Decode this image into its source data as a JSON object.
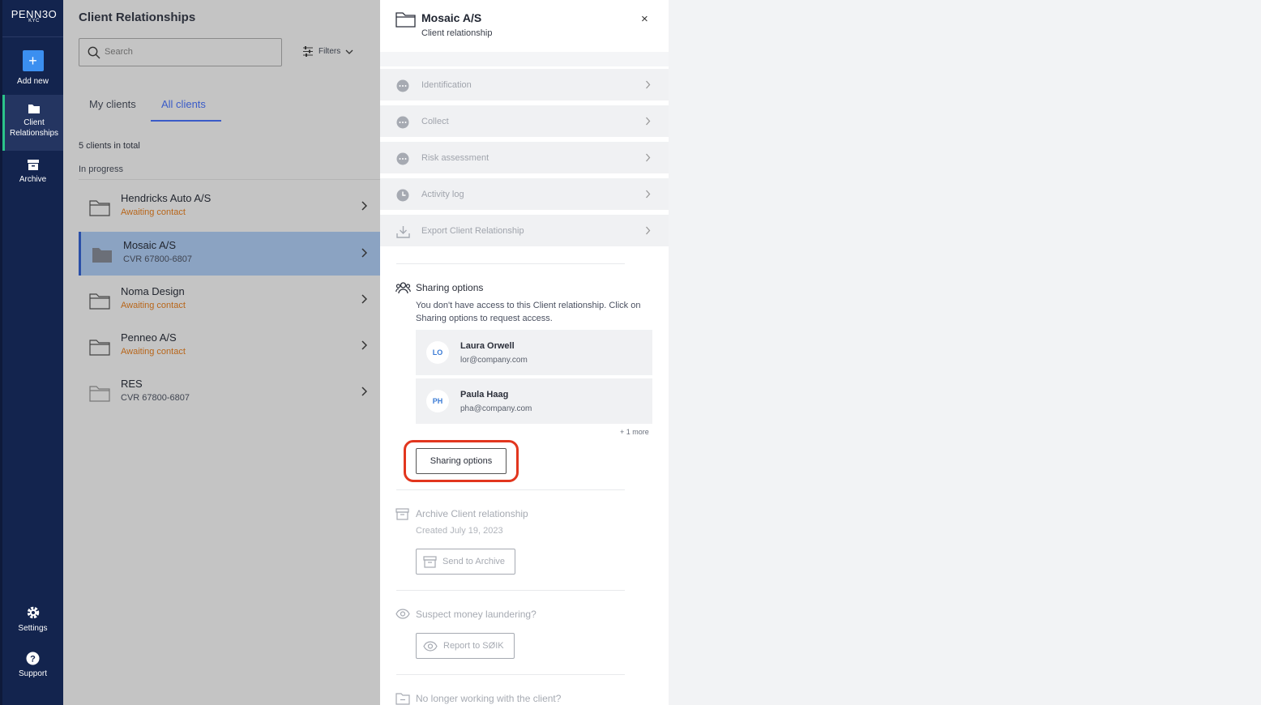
{
  "nav": {
    "brand": "PENN3O",
    "brand_sub": "KYC",
    "add_new": "Add new",
    "client_relationships": "Client Relationships",
    "archive": "Archive",
    "settings": "Settings",
    "support": "Support"
  },
  "list": {
    "title": "Client Relationships",
    "search_placeholder": "Search",
    "filters_label": "Filters",
    "tabs": [
      "My clients",
      "All clients"
    ],
    "active_tab": "All clients",
    "count": "5 clients in total",
    "section": "In progress",
    "rows": [
      {
        "name": "Hendricks Auto A/S",
        "meta": "Awaiting contact"
      },
      {
        "name": "Mosaic A/S",
        "meta": "CVR 67800-6807"
      },
      {
        "name": "Noma Design",
        "meta": "Awaiting contact"
      },
      {
        "name": "Penneo A/S",
        "meta": "Awaiting contact"
      },
      {
        "name": "RES",
        "meta": "CVR 67800-6807"
      }
    ]
  },
  "detail": {
    "title": "Mosaic A/S",
    "subtitle": "Client relationship",
    "close": "×",
    "sections": [
      "Identification",
      "Collect",
      "Risk assessment",
      "Activity log",
      "Export Client Relationship"
    ],
    "sharing": {
      "title": "Sharing options",
      "description": "You don't have access to this Client relationship. Click on Sharing options to request access.",
      "users": [
        {
          "initials": "LO",
          "name": "Laura Orwell",
          "email": "lor@company.com"
        },
        {
          "initials": "PH",
          "name": "Paula Haag",
          "email": "pha@company.com"
        }
      ],
      "more": "+ 1 more",
      "button": "Sharing options"
    },
    "archive": {
      "title": "Archive Client relationship",
      "created": "Created July 19, 2023",
      "button": "Send to Archive"
    },
    "laundering": {
      "title": "Suspect money laundering?",
      "button": "Report to SØIK"
    },
    "no_longer": {
      "title": "No longer working with the client?"
    }
  },
  "colors": {
    "nav_bg": "#13244e",
    "accent": "#3a5bc8",
    "warning": "#b8661a",
    "highlight": "#e2361e"
  }
}
